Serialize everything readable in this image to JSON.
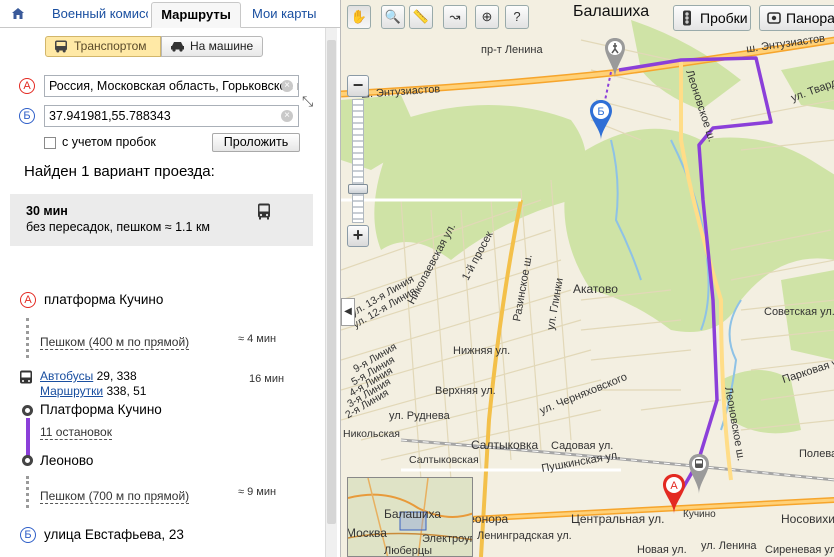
{
  "tabs": {
    "home_icon": "home-icon",
    "items": [
      {
        "label": "Военный комиссариат"
      },
      {
        "label": "Маршруты"
      },
      {
        "label": "Мои карты"
      }
    ],
    "active_index": 1
  },
  "modes": {
    "transport": "Транспортом",
    "car": "На машине",
    "active": "transport"
  },
  "route_form": {
    "point_a_letter": "А",
    "point_b_letter": "Б",
    "from_value": "Россия, Московская область, Горьковское шоссе",
    "to_value": "37.941981,55.788343",
    "traffic_label": "с учетом пробок",
    "traffic_checked": false,
    "submit_label": "Проложить"
  },
  "results": {
    "found_text": "Найден 1 вариант проезда:",
    "variant": {
      "time": "30 мин",
      "description": "без пересадок, пешком ≈ 1.1 км"
    }
  },
  "steps": {
    "start_name": "платформа Кучино",
    "walk1_text": "Пешком (400 м по прямой)",
    "walk1_time": "≈ 4 мин",
    "bus_label": "Автобусы",
    "bus_numbers": "29, 338",
    "minibus_label": "Маршрутки",
    "minibus_numbers": "338, 51",
    "ride_time": "16 мин",
    "board_stop": "Платформа Кучино",
    "stops_count": "11 остановок",
    "exit_stop": "Леоново",
    "walk2_text": "Пешком (700 м по прямой)",
    "walk2_time": "≈ 9 мин",
    "end_name": "улица Евстафьева, 23"
  },
  "map": {
    "city": "Балашиха",
    "traffic_button": "Пробки",
    "panorama_button": "Панорамы",
    "route_color": "#8b3fd9",
    "street_labels": [
      "пр-т Ленина",
      "ш. Энтузиастов",
      "ш. Энтузиастов",
      "Леоновское ш.",
      "ул. Твардовского",
      "Николаевская ул.",
      "1-й просек",
      "Разинское ш.",
      "ул. Глинки",
      "Акатово",
      "ул. 13-я Линия",
      "ул. 12-я Линия",
      "9-я Линия",
      "5-я Линия",
      "4-я Линия",
      "3-я Линия",
      "2-я Линия",
      "Нижняя ул.",
      "Верхняя ул.",
      "ул. Черняховского",
      "ул. Руднева",
      "Салтыковка",
      "Садовая ул.",
      "Пушкинская ул.",
      "Никольская",
      "Советская ул.",
      "Парковая ул.",
      "Полевая ул.",
      "Леоновское ш.",
      "Салтыковская",
      "Кучино",
      "Центральная ул.",
      "Носовихинское",
      "Новая ул.",
      "ул. Ленина",
      "Элеонора",
      "Ленинградская ул.",
      "Сиреневая ул."
    ],
    "minimap_labels": [
      "Балашиха",
      "Москва",
      "Электроугли",
      "Люберцы"
    ],
    "marker_a": "А",
    "marker_b": "Б"
  }
}
